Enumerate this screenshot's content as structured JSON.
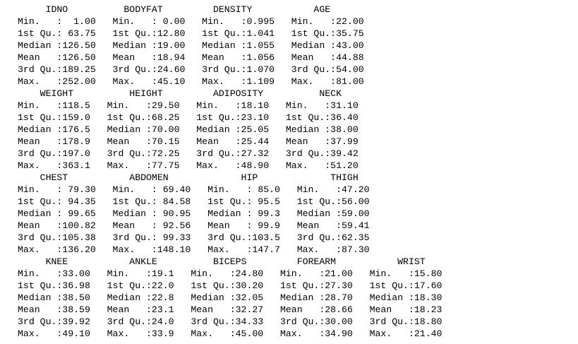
{
  "console": {
    "blocks": [
      {
        "header": "     IDNO          BODYFAT         DENSITY           AGE       ",
        "rows": [
          "Min.   :  1.00   Min.   : 0.00   Min.   :0.995   Min.   :22.00  ",
          "1st Qu.: 63.75   1st Qu.:12.80   1st Qu.:1.041   1st Qu.:35.75  ",
          "Median :126.50   Median :19.00   Median :1.055   Median :43.00  ",
          "Mean   :126.50   Mean   :18.94   Mean   :1.056   Mean   :44.88  ",
          "3rd Qu.:189.25   3rd Qu.:24.60   3rd Qu.:1.070   3rd Qu.:54.00  ",
          "Max.   :252.00   Max.   :45.10   Max.   :1.109   Max.   :81.00  "
        ]
      },
      {
        "header": "    WEIGHT          HEIGHT         ADIPOSITY          NECK      ",
        "rows": [
          "Min.   :118.5   Min.   :29.50   Min.   :18.10   Min.   :31.10  ",
          "1st Qu.:159.0   1st Qu.:68.25   1st Qu.:23.10   1st Qu.:36.40  ",
          "Median :176.5   Median :70.00   Median :25.05   Median :38.00  ",
          "Mean   :178.9   Mean   :70.15   Mean   :25.44   Mean   :37.99  ",
          "3rd Qu.:197.0   3rd Qu.:72.25   3rd Qu.:27.32   3rd Qu.:39.42  ",
          "Max.   :363.1   Max.   :77.75   Max.   :48.90   Max.   :51.20  "
        ]
      },
      {
        "header": "    CHEST           ABDOMEN             HIP             THIGH      ",
        "rows": [
          "Min.   : 79.30   Min.   : 69.40   Min.   : 85.0   Min.   :47.20  ",
          "1st Qu.: 94.35   1st Qu.: 84.58   1st Qu.: 95.5   1st Qu.:56.00  ",
          "Median : 99.65   Median : 90.95   Median : 99.3   Median :59.00  ",
          "Mean   :100.82   Mean   : 92.56   Mean   : 99.9   Mean   :59.41  ",
          "3rd Qu.:105.38   3rd Qu.: 99.33   3rd Qu.:103.5   3rd Qu.:62.35  ",
          "Max.   :136.20   Max.   :148.10   Max.   :147.7   Max.   :87.30  "
        ]
      },
      {
        "header": "     KNEE           ANKLE          BICEPS         FOREARM           WRIST      ",
        "rows": [
          "Min.   :33.00   Min.   :19.1   Min.   :24.80   Min.   :21.00   Min.   :15.80  ",
          "1st Qu.:36.98   1st Qu.:22.0   1st Qu.:30.20   1st Qu.:27.30   1st Qu.:17.60  ",
          "Median :38.50   Median :22.8   Median :32.05   Median :28.70   Median :18.30  ",
          "Mean   :38.59   Mean   :23.1   Mean   :32.27   Mean   :28.66   Mean   :18.23  ",
          "3rd Qu.:39.92   3rd Qu.:24.0   3rd Qu.:34.33   3rd Qu.:30.00   3rd Qu.:18.80  ",
          "Max.   :49.10   Max.   :33.9   Max.   :45.00   Max.   :34.90   Max.   :21.40  "
        ]
      }
    ]
  }
}
